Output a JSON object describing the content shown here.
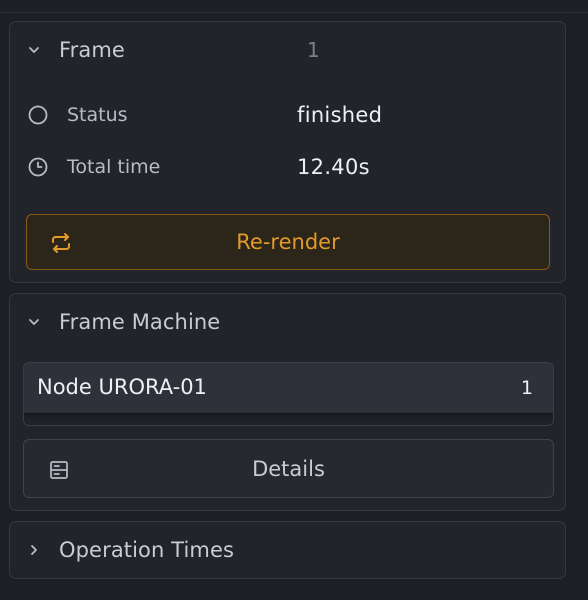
{
  "frame_panel": {
    "title": "Frame",
    "frame_number": "1",
    "status_label": "Status",
    "status_value": "finished",
    "total_time_label": "Total time",
    "total_time_value": "12.40s",
    "rerender_label": "Re-render",
    "expanded": true
  },
  "machine_panel": {
    "title": "Frame Machine",
    "node_name": "Node URORA-01",
    "node_count": "1",
    "details_label": "Details",
    "expanded": true
  },
  "operation_panel": {
    "title": "Operation Times",
    "expanded": false
  },
  "icons": {
    "frame_chevron": "chevron-down-icon",
    "status": "circle-icon",
    "total_time": "clock-icon",
    "rerender": "repeat-icon",
    "machine_chevron": "chevron-down-icon",
    "details": "list-icon",
    "operation_chevron": "chevron-right-icon"
  },
  "colors": {
    "background": "#1c1f25",
    "panel": "#21242b",
    "accent": "#e39a2b",
    "accent_border": "#8a5a15",
    "text": "#c9ccd2",
    "text_bright": "#eef0f3",
    "text_muted": "#7c818b"
  }
}
